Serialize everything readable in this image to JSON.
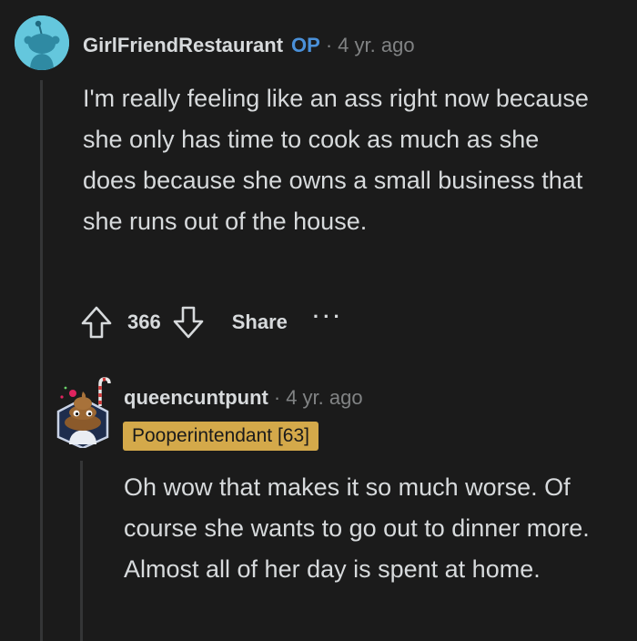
{
  "comment": {
    "username": "GirlFriendRestaurant",
    "op_tag": "OP",
    "separator": "·",
    "time": "4 yr. ago",
    "body": "I'm really feeling like an ass right now because she only has time to cook as much as she does because she owns a small business that she runs out of the house.",
    "actions": {
      "score": "366",
      "share_label": "Share",
      "more_label": "···"
    }
  },
  "reply": {
    "username": "queencuntpunt",
    "separator": "·",
    "time": "4 yr. ago",
    "flair": "Pooperintendant [63]",
    "body": "Oh wow that makes it so much worse. Of course she wants to go out to dinner more. Almost all of her day is spent at home."
  },
  "colors": {
    "background": "#1b1b1b",
    "text": "#d7dadc",
    "muted": "#818384",
    "op_blue": "#4a90d9",
    "flair_bg": "#d4a94a",
    "thread_line": "#343536",
    "avatar_bg": "#64c7dd"
  },
  "icons": {
    "avatar_1": "reddit-snoo-avatar",
    "avatar_2": "poop-emoji-avatar",
    "upvote": "upvote-arrow-icon",
    "downvote": "downvote-arrow-icon",
    "more": "overflow-dots-icon"
  }
}
